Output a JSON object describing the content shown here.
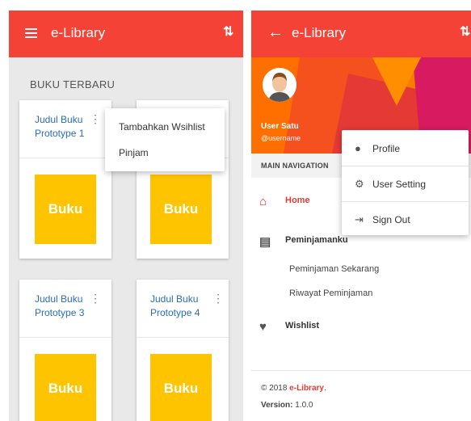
{
  "left": {
    "appbar_title": "e-Library",
    "section_title": "BUKU TERBARU",
    "cards": [
      {
        "title": "Judul Buku Prototype 1",
        "cover": "Buku"
      },
      {
        "title": "",
        "cover": "Buku"
      },
      {
        "title": "Judul Buku Prototype 3",
        "cover": "Buku"
      },
      {
        "title": "Judul Buku Prototype 4",
        "cover": "Buku"
      }
    ],
    "popup": {
      "wishlist": "Tambahkan Wsihlist",
      "borrow": "Pinjam"
    }
  },
  "right": {
    "appbar_title": "e-Library",
    "user_name": "User Satu",
    "user_handle": "@username",
    "nav_header": "MAIN NAVIGATION",
    "nav": {
      "home": "Home",
      "loans": "Peminjamanku",
      "current_loans": "Peminjaman Sekarang",
      "loan_history": "Riwayat Peminjaman",
      "wishlist": "Wishlist"
    },
    "footer": {
      "copyright_prefix": "© 2018 ",
      "brand": "e-Library",
      "period": ".",
      "version_label": "Version:",
      "version": " 1.0.0"
    },
    "dropdown": {
      "profile": "Profile",
      "user_setting": "User Setting",
      "sign_out": "Sign Out"
    }
  },
  "colors": {
    "primary": "#f44336",
    "cover": "#ffc400",
    "link": "#2a6db3"
  },
  "icons": {
    "menu": "menu-icon",
    "sort": "sort-icon",
    "back": "arrow-left-icon",
    "home": "home-icon",
    "book": "book-icon",
    "heart": "heart-icon",
    "person": "person-icon",
    "gear": "gear-icon",
    "sign_out": "sign-out-icon"
  }
}
